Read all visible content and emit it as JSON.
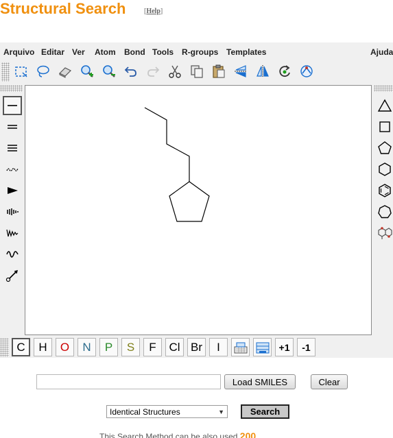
{
  "header": {
    "title": "Structural Search",
    "help_label": "Help",
    "help_open": "[",
    "help_close": "]"
  },
  "menu": {
    "items": [
      "Arquivo",
      "Editar",
      "Ver",
      "Atom",
      "Bond",
      "Tools",
      "R-groups",
      "Templates"
    ],
    "help": "Ajuda"
  },
  "toolbar": {
    "icons": [
      "select-rectangle-icon",
      "lasso-icon",
      "eraser-icon",
      "zoom-in-icon",
      "zoom-out-icon",
      "undo-icon",
      "redo-icon",
      "cut-icon",
      "copy-icon",
      "paste-icon",
      "flip-horizontal-icon",
      "flip-vertical-icon",
      "rotate-icon",
      "clean-structure-icon"
    ]
  },
  "left_tools": {
    "icons": [
      "single-bond-icon",
      "double-bond-icon",
      "triple-bond-icon",
      "any-bond-icon",
      "wedge-bond-icon",
      "hash-bond-icon",
      "zigzag-bond-icon",
      "wavy-bond-icon",
      "chain-icon"
    ]
  },
  "right_tools": {
    "icons": [
      "triangle-ring-icon",
      "square-ring-icon",
      "pentagon-ring-icon",
      "hexagon-ring-icon",
      "benzene-ring-icon",
      "heptagon-ring-icon",
      "template-icon"
    ]
  },
  "elements": [
    {
      "label": "C",
      "color": "#000000"
    },
    {
      "label": "H",
      "color": "#000000"
    },
    {
      "label": "O",
      "color": "#cc0000"
    },
    {
      "label": "N",
      "color": "#2c6c8c"
    },
    {
      "label": "P",
      "color": "#2a8a2a"
    },
    {
      "label": "S",
      "color": "#7f7f1a"
    },
    {
      "label": "F",
      "color": "#000000"
    },
    {
      "label": "Cl",
      "color": "#000000"
    },
    {
      "label": "Br",
      "color": "#000000"
    },
    {
      "label": "I",
      "color": "#000000"
    }
  ],
  "charge": {
    "plus": "+1",
    "minus": "-1"
  },
  "smiles": {
    "value": "",
    "load_label": "Load SMILES",
    "clear_label": "Clear"
  },
  "search": {
    "mode": "Identical Structures",
    "button_label": "Search"
  },
  "footer": {
    "text": "This Search Method can be also used",
    "number": "200"
  }
}
